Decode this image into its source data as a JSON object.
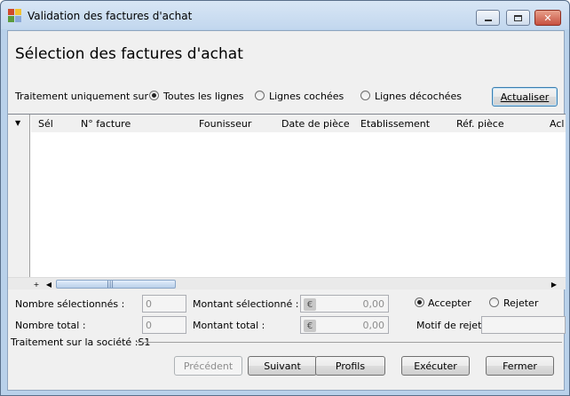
{
  "window": {
    "title": "Validation des factures d'achat",
    "icon_colors": [
      "#d04a2a",
      "#f2c230",
      "#5b9b3c",
      "#8aa8d8"
    ]
  },
  "header": {
    "title": "Sélection des factures d'achat"
  },
  "filter": {
    "label": "Traitement uniquement sur :",
    "options": [
      {
        "label": "Toutes les lignes",
        "selected": true
      },
      {
        "label": "Lignes cochées",
        "selected": false
      },
      {
        "label": "Lignes décochées",
        "selected": false
      }
    ],
    "refresh_label": "Actualiser"
  },
  "grid": {
    "columns": [
      "Sél",
      "N° facture",
      "Founisseur",
      "Date de pièce",
      "Etablissement",
      "Réf. pièce",
      "Acl"
    ],
    "rows": []
  },
  "summary": {
    "selected_count_label": "Nombre sélectionnés :",
    "selected_count": "0",
    "total_count_label": "Nombre total :",
    "total_count": "0",
    "selected_amount_label": "Montant sélectionné :",
    "selected_amount": "0,00",
    "total_amount_label": "Montant total :",
    "total_amount": "0,00",
    "currency_icon": "euro-icon",
    "accept_label": "Accepter",
    "accept_selected": true,
    "reject_label": "Rejeter",
    "reject_selected": false,
    "reject_reason_label": "Motif de rejet :",
    "reject_reason": ""
  },
  "company_label": "Traitement sur la société :S1",
  "buttons": {
    "previous": "Précédent",
    "next": "Suivant",
    "profiles": "Profils",
    "execute": "Exécuter",
    "close": "Fermer"
  }
}
